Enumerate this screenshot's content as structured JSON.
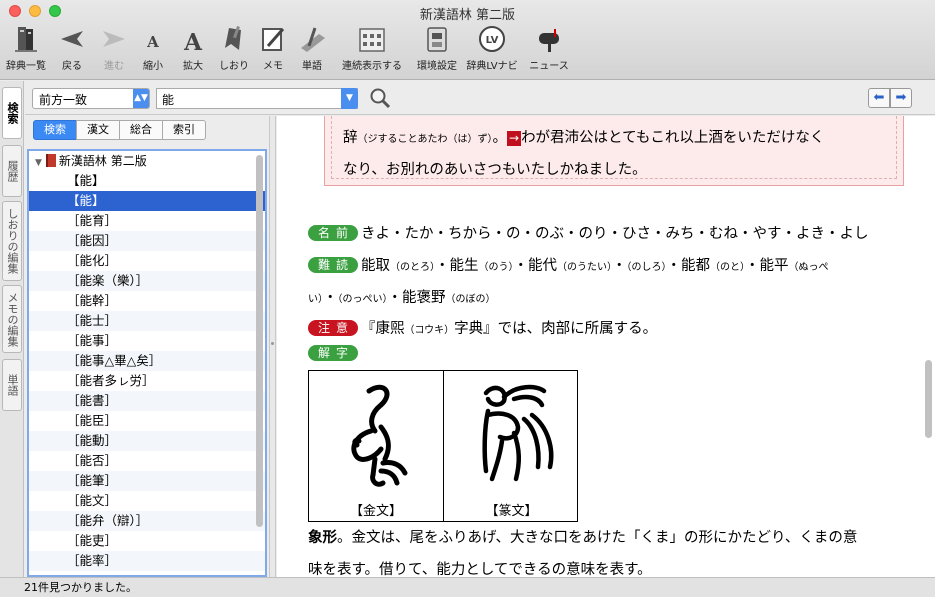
{
  "window": {
    "title": "新漢語林 第二版"
  },
  "toolbar": [
    {
      "id": "dict-list",
      "label": "辞典一覧",
      "icon": "books-icon",
      "enabled": true
    },
    {
      "id": "back",
      "label": "戻る",
      "icon": "back-arrow-icon",
      "enabled": true
    },
    {
      "id": "forward",
      "label": "進む",
      "icon": "forward-arrow-icon",
      "enabled": false
    },
    {
      "id": "shrink",
      "label": "縮小",
      "icon": "font-shrink-icon",
      "enabled": true
    },
    {
      "id": "enlarge",
      "label": "拡大",
      "icon": "font-enlarge-icon",
      "enabled": true
    },
    {
      "id": "bookmark",
      "label": "しおり",
      "icon": "bookmark-icon",
      "enabled": true
    },
    {
      "id": "memo",
      "label": "メモ",
      "icon": "memo-icon",
      "enabled": true
    },
    {
      "id": "word",
      "label": "単語",
      "icon": "word-card-icon",
      "enabled": true
    },
    {
      "id": "continuous",
      "label": "連続表示する",
      "icon": "calendar-grid-icon",
      "enabled": true
    },
    {
      "id": "settings",
      "label": "環境設定",
      "icon": "settings-switch-icon",
      "enabled": true
    },
    {
      "id": "lvnavi",
      "label": "辞典LVナビ",
      "icon": "lv-navi-icon",
      "enabled": true
    },
    {
      "id": "news",
      "label": "ニュース",
      "icon": "mailbox-icon",
      "enabled": true
    }
  ],
  "side_tabs": [
    {
      "id": "search",
      "label": "検索",
      "active": true
    },
    {
      "id": "history",
      "label": "履歴",
      "active": false
    },
    {
      "id": "bookmark-edit",
      "label": "しおりの編集",
      "active": false
    },
    {
      "id": "memo-edit",
      "label": "メモの編集",
      "active": false
    },
    {
      "id": "words",
      "label": "単語",
      "active": false
    }
  ],
  "search": {
    "mode": "前方一致",
    "query": "能"
  },
  "subtabs": [
    {
      "label": "検索",
      "active": true
    },
    {
      "label": "漢文",
      "active": false
    },
    {
      "label": "総合",
      "active": false
    },
    {
      "label": "索引",
      "active": false
    }
  ],
  "tree": {
    "root": "新漢語林 第二版",
    "entries": [
      "【能】",
      "【能】",
      "［能育］",
      "［能因］",
      "［能化］",
      "［能楽（樂）］",
      "［能幹］",
      "［能士］",
      "［能事］",
      "［能事△畢△矣］",
      "［能者多ㇾ労］",
      "［能書］",
      "［能臣］",
      "［能動］",
      "［能否］",
      "［能筆］",
      "［能文］",
      "［能弁（辯）］",
      "［能吏］",
      "［能率］"
    ],
    "selected_index": 1
  },
  "content": {
    "box_line1_prefix": "辞",
    "box_line1_reading": "（ジすることあたわ（は）ず）",
    "box_line1_punct": "。",
    "box_arrow": "→",
    "box_line1_rest": "わが君沛公はとてもこれ以上酒をいただけなく",
    "box_line2": "なり、お別れのあいさつもいたしかねました。",
    "badge_name": "名前",
    "name_text": "きよ・たか・ちから・の・のぶ・のり・ひさ・みち・むね・やす・よき・よし",
    "badge_difficult": "難読",
    "difficult_line1": [
      {
        "word": "能取",
        "reading": "（のとろ）"
      },
      {
        "word": "・能生",
        "reading": "（のう）"
      },
      {
        "word": "・能代",
        "reading": "（のうたい）"
      },
      {
        "word": "・",
        "reading": "（のしろ）"
      },
      {
        "word": "・能都",
        "reading": "（のと）"
      },
      {
        "word": "・能平",
        "reading": "（ぬっぺ"
      }
    ],
    "difficult_line2_a": "い）",
    "difficult_line2_b": "・",
    "difficult_line2_c": "（のっぺい）",
    "difficult_line2_d": "・能褒野",
    "difficult_line2_e": "（のぼの）",
    "badge_note": "注意",
    "note_a": "『康煕",
    "note_reading": "（コウキ）",
    "note_b": "字典』では、肉部に所属する。",
    "badge_explain": "解字",
    "glyph1_caption": "【金文】",
    "glyph2_caption": "【篆文】",
    "explain_bold": "象形",
    "explain_line1": "。金文は、尾をふりあげ、大きな口をあけた「くま」の形にかたどり、くまの意",
    "explain_line2": "味を表す。借りて、能力としてできるの意味を表す。"
  },
  "status": {
    "text": "21件見つかりました。"
  }
}
